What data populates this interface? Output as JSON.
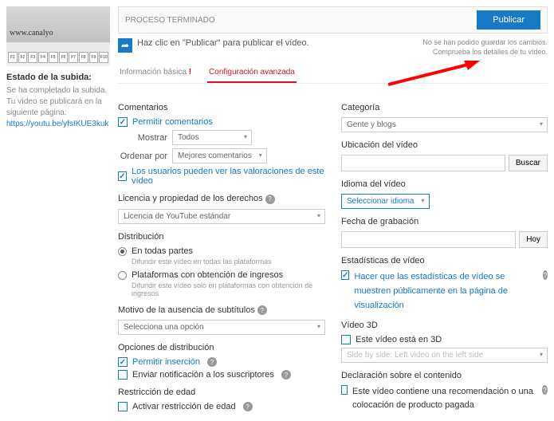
{
  "sidebar": {
    "thumb_url": "www.canalyo",
    "status_title": "Estado de la subida:",
    "status_done": "Se ha completado la subida.",
    "status_pub": "Tu vídeo se publicará en la siguiente página: ",
    "video_link": "https://youtu.be/yfsIKUE3kuk"
  },
  "header": {
    "process": "PROCESO TERMINADO",
    "publish": "Publicar",
    "hint": "Haz clic en \"Publicar\" para publicar el vídeo.",
    "save1": "No se han podido guardar los cambios.",
    "save2": "Comprueba los detalles de tu vídeo."
  },
  "tabs": {
    "basic": "Información básica",
    "advanced": "Configuración avanzada"
  },
  "left": {
    "comments_title": "Comentarios",
    "allow_comments": "Permitir comentarios",
    "show": "Mostrar",
    "show_val": "Todos",
    "order": "Ordenar por",
    "order_val": "Mejores comentarios",
    "ratings": "Los usuarios pueden ver las valoraciones de este vídeo",
    "license_title": "Licencia y propiedad de los derechos",
    "license_val": "Licencia de YouTube estándar",
    "dist_title": "Distribución",
    "dist1": "En todas partes",
    "dist1_sub": "Difundir este vídeo en todas las plataformas",
    "dist2": "Plataformas con obtención de ingresos",
    "dist2_sub": "Difundir este vídeo solo en plataformas con obtención de ingresos",
    "subs_title": "Motivo de la ausencia de subtítulos",
    "subs_val": "Selecciona una opción",
    "distopt_title": "Opciones de distribución",
    "embed": "Permitir inserción",
    "notify": "Enviar notificación a los suscriptores",
    "age_title": "Restricción de edad",
    "age": "Activar restricción de edad"
  },
  "right": {
    "cat_title": "Categoría",
    "cat_val": "Gente y blogs",
    "loc_title": "Ubicación del vídeo",
    "loc_btn": "Buscar",
    "lang_title": "Idioma del vídeo",
    "lang_val": "Seleccionar idioma",
    "date_title": "Fecha de grabación",
    "date_btn": "Hoy",
    "stats_title": "Estadísticas de vídeo",
    "stats": "Hacer que las estadísticas de vídeo se muestren públicamente en la página de visualización",
    "v3d_title": "Vídeo 3D",
    "v3d": "Este vídeo está en 3D",
    "v3d_val": "Side by side: Left video on the left side",
    "decl_title": "Declaración sobre el contenido",
    "decl": "Este vídeo contiene una recomendación o una colocación de producto pagada"
  }
}
